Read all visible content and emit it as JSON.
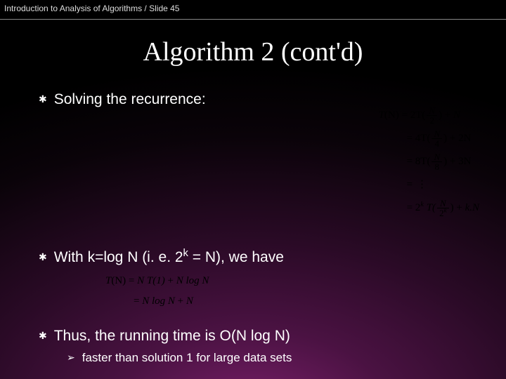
{
  "header": "Introduction to Analysis of Algorithms / Slide 45",
  "title": "Algorithm 2 (cont'd)",
  "bullets": {
    "b1": "Solving the recurrence:",
    "b2_pre": "With k=log N (i. e. 2",
    "b2_sup": "k",
    "b2_post": " = N), we have",
    "b3": "Thus, the running time is O(N log N)",
    "sub1": "faster than solution 1 for large data sets"
  },
  "eq_right": {
    "l1_a": "T",
    "l1_b": "(N)",
    "l1_c": "=",
    "l1_d": "2T(",
    "l1_fn": "N",
    "l1_fd": "2",
    "l1_e": ")",
    "l1_f": "+",
    "l1_g": "N",
    "l2_a": "=",
    "l2_b": "4T(",
    "l2_fn": "N",
    "l2_fd": "4",
    "l2_c": ")",
    "l2_d": "+",
    "l2_e": "2N",
    "l3_a": "=",
    "l3_b": "8T(",
    "l3_fn": "N",
    "l3_fd": "8",
    "l3_c": ")",
    "l3_d": "+",
    "l3_e": "3N",
    "l4_a": "=",
    "l4_b": "⋮",
    "l5_a": "=",
    "l5_b": "2",
    "l5_sup": "k",
    "l5_c": " T(",
    "l5_fn": "N",
    "l5_fd1": "2",
    "l5_fdk": "k",
    "l5_d": ")",
    "l5_e": "+",
    "l5_f": "k.N"
  },
  "eq_mid": {
    "l1_a": "T",
    "l1_b": "(N)",
    "l1_c": "=",
    "l1_d": "N T(1)",
    "l1_e": "+",
    "l1_f": "N log N",
    "l2_a": "=",
    "l2_b": "N log N",
    "l2_c": "+",
    "l2_d": "N"
  }
}
